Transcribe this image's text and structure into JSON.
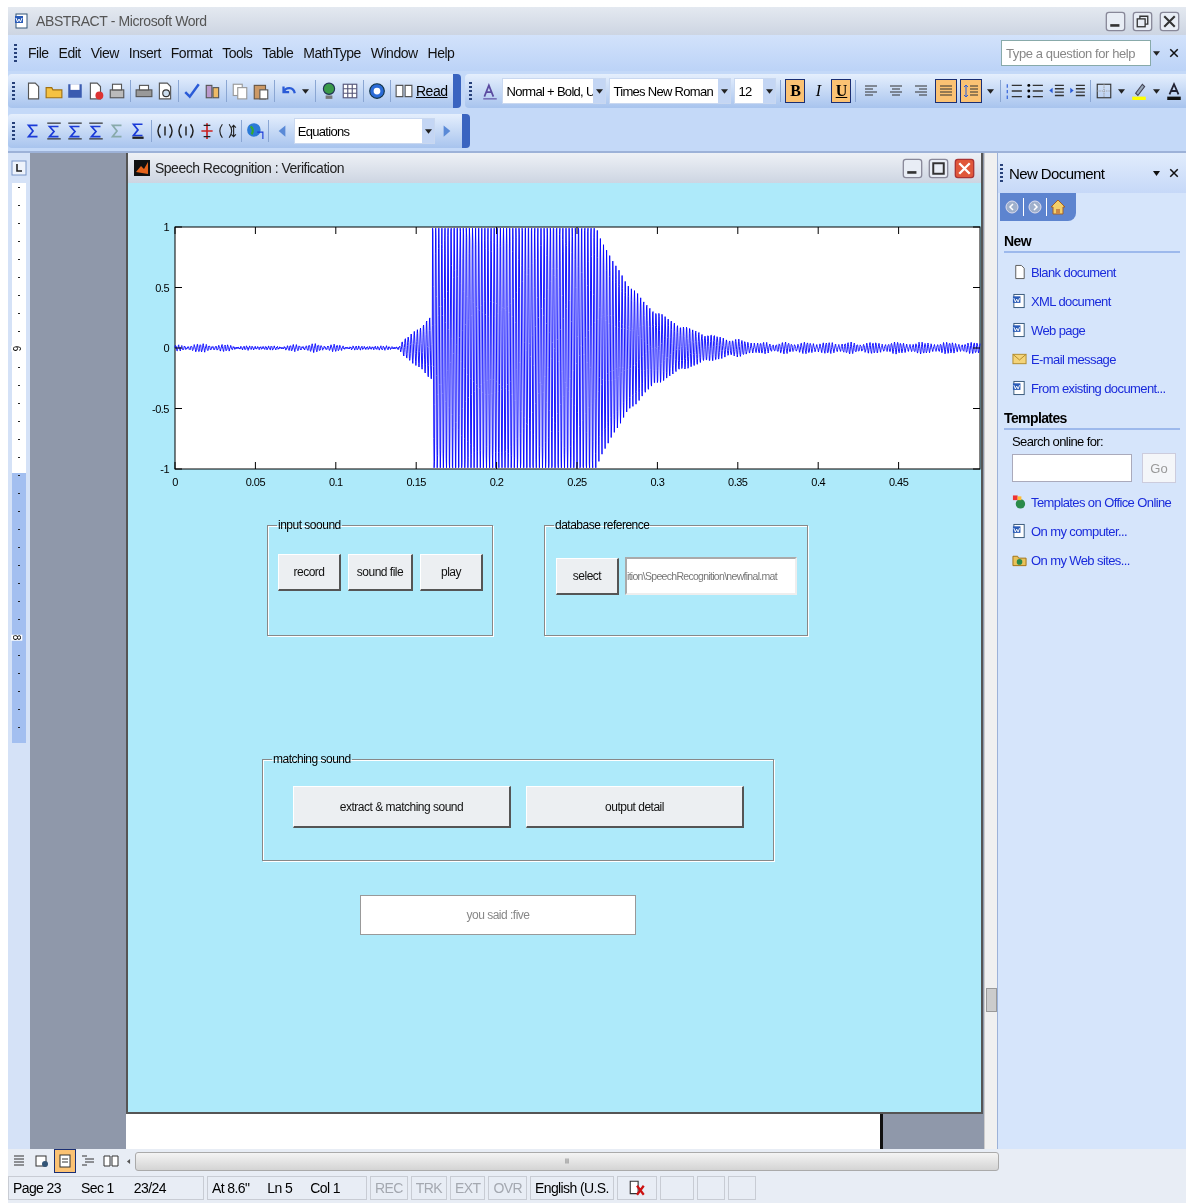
{
  "window": {
    "title": "ABSTRACT - Microsoft Word"
  },
  "menu": [
    "File",
    "Edit",
    "View",
    "Insert",
    "Format",
    "Tools",
    "Table",
    "MathType",
    "Window",
    "Help"
  ],
  "help_search": {
    "placeholder": "Type a question for help"
  },
  "standard_toolbar": {
    "read_button": "Read"
  },
  "formatting_toolbar": {
    "style": "Normal + Bold, U",
    "font": "Times New Roman",
    "size": "12",
    "text_buttons": [
      {
        "label": "B",
        "selected": true
      },
      {
        "label": "I",
        "selected": false
      },
      {
        "label": "U",
        "selected": true
      }
    ],
    "alignment": [
      {
        "selected": false
      },
      {
        "selected": false
      },
      {
        "selected": false
      },
      {
        "selected": true
      }
    ],
    "line_spacing": {
      "selected": true
    }
  },
  "mathtype_toolbar": {
    "equations": "Equations"
  },
  "ruler": {
    "labels": [
      "6",
      "8"
    ]
  },
  "figure": {
    "title": "Speech Recognition : Verification",
    "plot": {
      "y_ticks": [
        "1",
        "0.5",
        "0",
        "-0.5",
        "-1"
      ],
      "x_ticks": [
        "0",
        "0.05",
        "0.1",
        "0.15",
        "0.2",
        "0.25",
        "0.3",
        "0.35",
        "0.4",
        "0.45"
      ]
    },
    "groups": [
      {
        "title": "input soound",
        "buttons": [
          "record",
          "sound file",
          "play"
        ]
      },
      {
        "title": "database reference",
        "buttons": [
          "select"
        ],
        "path": "ition\\SpeechRecognition\\newfinal.mat"
      },
      {
        "title": "matching sound",
        "buttons": [
          "extract & matching sound",
          "output detail"
        ]
      }
    ],
    "result": "you said :five"
  },
  "task_pane": {
    "title": "New Document",
    "new_section": {
      "title": "New",
      "links": [
        "Blank document",
        "XML document",
        "Web page",
        "E-mail message",
        "From existing document..."
      ]
    },
    "templates_section": {
      "title": "Templates",
      "search_label": "Search online for:",
      "go_button": "Go",
      "links": [
        "Templates on Office Online",
        "On my computer...",
        "On my Web sites..."
      ]
    }
  },
  "view_buttons": [
    {
      "selected": false
    },
    {
      "selected": false
    },
    {
      "selected": true
    },
    {
      "selected": false
    },
    {
      "selected": false
    }
  ],
  "status_bar": {
    "cells": [
      "Page 23",
      "Sec 1",
      "23/24",
      "At 8.6\"",
      "Ln 5",
      "Col 1"
    ],
    "modes": [
      {
        "label": "REC",
        "disabled": true
      },
      {
        "label": "TRK",
        "disabled": true
      },
      {
        "label": "EXT",
        "disabled": true
      },
      {
        "label": "OVR",
        "disabled": true
      }
    ],
    "language": "English (U.S."
  }
}
